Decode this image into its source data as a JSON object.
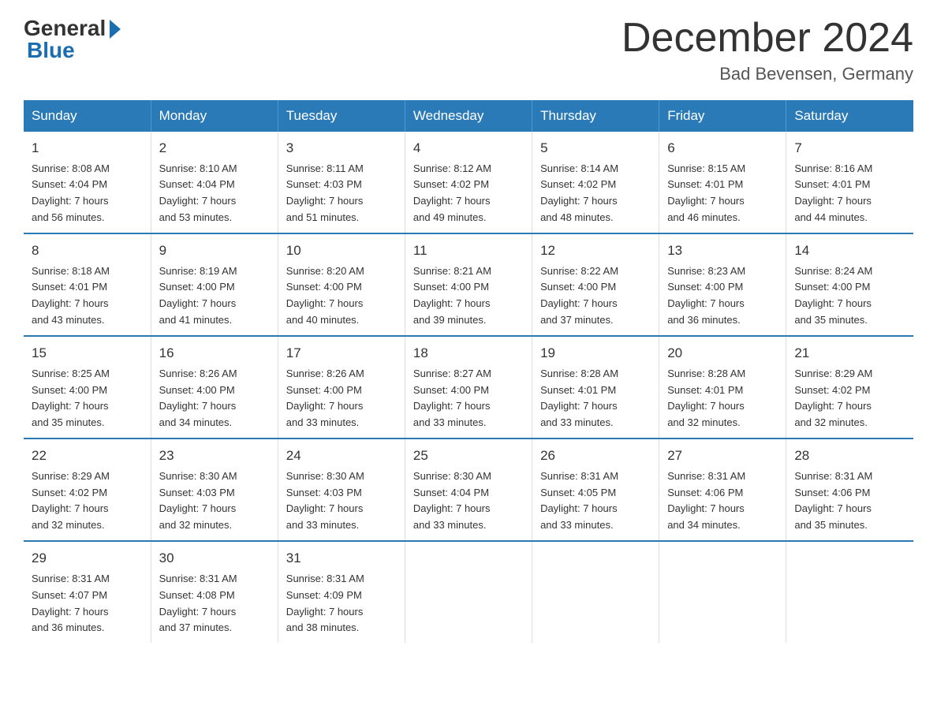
{
  "logo": {
    "general": "General",
    "blue": "Blue"
  },
  "title": "December 2024",
  "location": "Bad Bevensen, Germany",
  "days_of_week": [
    "Sunday",
    "Monday",
    "Tuesday",
    "Wednesday",
    "Thursday",
    "Friday",
    "Saturday"
  ],
  "weeks": [
    [
      {
        "day": "1",
        "sunrise": "8:08 AM",
        "sunset": "4:04 PM",
        "daylight": "7 hours and 56 minutes."
      },
      {
        "day": "2",
        "sunrise": "8:10 AM",
        "sunset": "4:04 PM",
        "daylight": "7 hours and 53 minutes."
      },
      {
        "day": "3",
        "sunrise": "8:11 AM",
        "sunset": "4:03 PM",
        "daylight": "7 hours and 51 minutes."
      },
      {
        "day": "4",
        "sunrise": "8:12 AM",
        "sunset": "4:02 PM",
        "daylight": "7 hours and 49 minutes."
      },
      {
        "day": "5",
        "sunrise": "8:14 AM",
        "sunset": "4:02 PM",
        "daylight": "7 hours and 48 minutes."
      },
      {
        "day": "6",
        "sunrise": "8:15 AM",
        "sunset": "4:01 PM",
        "daylight": "7 hours and 46 minutes."
      },
      {
        "day": "7",
        "sunrise": "8:16 AM",
        "sunset": "4:01 PM",
        "daylight": "7 hours and 44 minutes."
      }
    ],
    [
      {
        "day": "8",
        "sunrise": "8:18 AM",
        "sunset": "4:01 PM",
        "daylight": "7 hours and 43 minutes."
      },
      {
        "day": "9",
        "sunrise": "8:19 AM",
        "sunset": "4:00 PM",
        "daylight": "7 hours and 41 minutes."
      },
      {
        "day": "10",
        "sunrise": "8:20 AM",
        "sunset": "4:00 PM",
        "daylight": "7 hours and 40 minutes."
      },
      {
        "day": "11",
        "sunrise": "8:21 AM",
        "sunset": "4:00 PM",
        "daylight": "7 hours and 39 minutes."
      },
      {
        "day": "12",
        "sunrise": "8:22 AM",
        "sunset": "4:00 PM",
        "daylight": "7 hours and 37 minutes."
      },
      {
        "day": "13",
        "sunrise": "8:23 AM",
        "sunset": "4:00 PM",
        "daylight": "7 hours and 36 minutes."
      },
      {
        "day": "14",
        "sunrise": "8:24 AM",
        "sunset": "4:00 PM",
        "daylight": "7 hours and 35 minutes."
      }
    ],
    [
      {
        "day": "15",
        "sunrise": "8:25 AM",
        "sunset": "4:00 PM",
        "daylight": "7 hours and 35 minutes."
      },
      {
        "day": "16",
        "sunrise": "8:26 AM",
        "sunset": "4:00 PM",
        "daylight": "7 hours and 34 minutes."
      },
      {
        "day": "17",
        "sunrise": "8:26 AM",
        "sunset": "4:00 PM",
        "daylight": "7 hours and 33 minutes."
      },
      {
        "day": "18",
        "sunrise": "8:27 AM",
        "sunset": "4:00 PM",
        "daylight": "7 hours and 33 minutes."
      },
      {
        "day": "19",
        "sunrise": "8:28 AM",
        "sunset": "4:01 PM",
        "daylight": "7 hours and 33 minutes."
      },
      {
        "day": "20",
        "sunrise": "8:28 AM",
        "sunset": "4:01 PM",
        "daylight": "7 hours and 32 minutes."
      },
      {
        "day": "21",
        "sunrise": "8:29 AM",
        "sunset": "4:02 PM",
        "daylight": "7 hours and 32 minutes."
      }
    ],
    [
      {
        "day": "22",
        "sunrise": "8:29 AM",
        "sunset": "4:02 PM",
        "daylight": "7 hours and 32 minutes."
      },
      {
        "day": "23",
        "sunrise": "8:30 AM",
        "sunset": "4:03 PM",
        "daylight": "7 hours and 32 minutes."
      },
      {
        "day": "24",
        "sunrise": "8:30 AM",
        "sunset": "4:03 PM",
        "daylight": "7 hours and 33 minutes."
      },
      {
        "day": "25",
        "sunrise": "8:30 AM",
        "sunset": "4:04 PM",
        "daylight": "7 hours and 33 minutes."
      },
      {
        "day": "26",
        "sunrise": "8:31 AM",
        "sunset": "4:05 PM",
        "daylight": "7 hours and 33 minutes."
      },
      {
        "day": "27",
        "sunrise": "8:31 AM",
        "sunset": "4:06 PM",
        "daylight": "7 hours and 34 minutes."
      },
      {
        "day": "28",
        "sunrise": "8:31 AM",
        "sunset": "4:06 PM",
        "daylight": "7 hours and 35 minutes."
      }
    ],
    [
      {
        "day": "29",
        "sunrise": "8:31 AM",
        "sunset": "4:07 PM",
        "daylight": "7 hours and 36 minutes."
      },
      {
        "day": "30",
        "sunrise": "8:31 AM",
        "sunset": "4:08 PM",
        "daylight": "7 hours and 37 minutes."
      },
      {
        "day": "31",
        "sunrise": "8:31 AM",
        "sunset": "4:09 PM",
        "daylight": "7 hours and 38 minutes."
      },
      null,
      null,
      null,
      null
    ]
  ],
  "labels": {
    "sunrise": "Sunrise:",
    "sunset": "Sunset:",
    "daylight": "Daylight:"
  }
}
